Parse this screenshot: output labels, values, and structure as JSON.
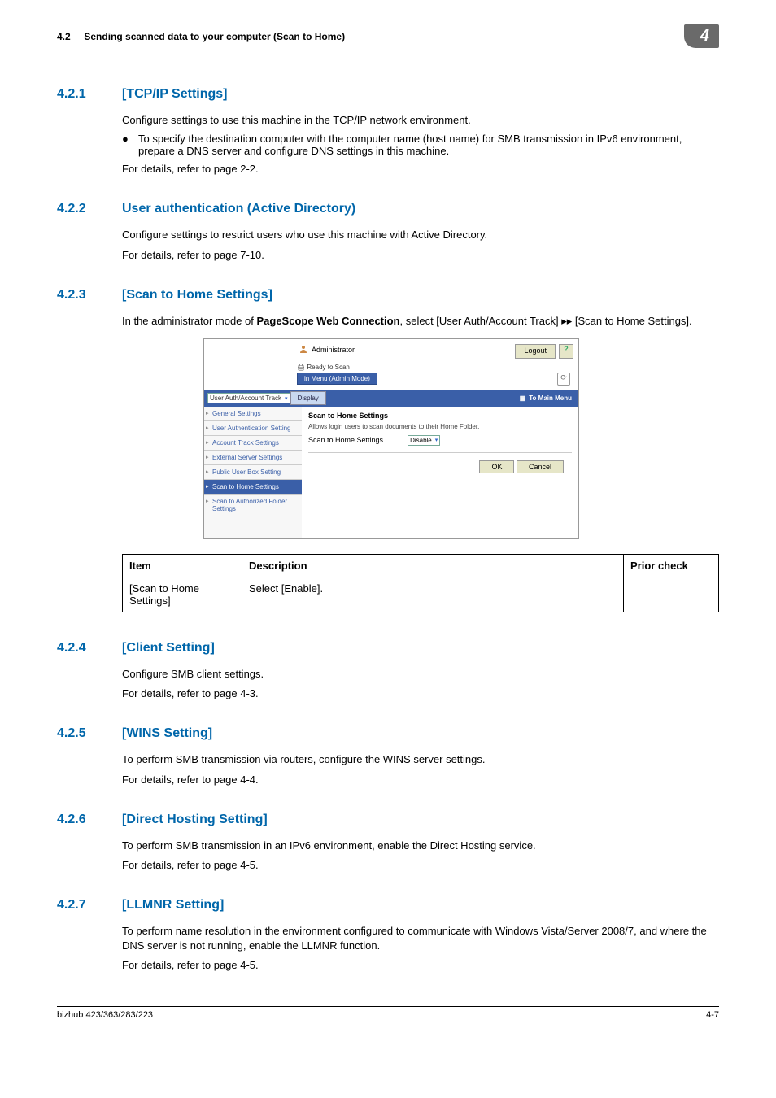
{
  "header": {
    "section_num": "4.2",
    "section_title": "Sending scanned data to your computer (Scan to Home)",
    "chapter_badge": "4"
  },
  "sections": {
    "s421": {
      "num": "4.2.1",
      "title": "[TCP/IP Settings]",
      "p1": "Configure settings to use this machine in the TCP/IP network environment.",
      "bullet1": "To specify the destination computer with the computer name (host name) for SMB transmission in IPv6 environment, prepare a DNS server and configure DNS settings in this machine.",
      "p2": "For details, refer to page 2-2."
    },
    "s422": {
      "num": "4.2.2",
      "title": "User authentication (Active Directory)",
      "p1": "Configure settings to restrict users who use this machine with Active Directory.",
      "p2": "For details, refer to page 7-10."
    },
    "s423": {
      "num": "4.2.3",
      "title": "[Scan to Home Settings]",
      "p1_pre": "In the administrator mode of ",
      "p1_bold": "PageScope Web Connection",
      "p1_post": ", select [User Auth/Account Track] ▸▸ [Scan to Home Settings]."
    },
    "s424": {
      "num": "4.2.4",
      "title": "[Client Setting]",
      "p1": "Configure SMB client settings.",
      "p2": "For details, refer to page 4-3."
    },
    "s425": {
      "num": "4.2.5",
      "title": "[WINS Setting]",
      "p1": "To perform SMB transmission via routers, configure the WINS server settings.",
      "p2": "For details, refer to page 4-4."
    },
    "s426": {
      "num": "4.2.6",
      "title": "[Direct Hosting Setting]",
      "p1": "To perform SMB transmission in an IPv6 environment, enable the Direct Hosting service.",
      "p2": "For details, refer to page 4-5."
    },
    "s427": {
      "num": "4.2.7",
      "title": "[LLMNR Setting]",
      "p1": "To perform name resolution in the environment configured to communicate with Windows Vista/Server 2008/7, and where the DNS server is not running, enable the LLMNR function.",
      "p2": "For details, refer to page 4-5."
    }
  },
  "screenshot": {
    "admin_label": "Administrator",
    "logout": "Logout",
    "help": "?",
    "ready": "Ready to Scan",
    "menu_mode": "in Menu (Admin Mode)",
    "dropdown": "User Auth/Account Track",
    "display": "Display",
    "to_main_menu": "To Main Menu",
    "sidebar": {
      "i0": "General Settings",
      "i1": "User Authentication Setting",
      "i2": "Account Track Settings",
      "i3": "External Server Settings",
      "i4": "Public User Box Setting",
      "i5": "Scan to Home Settings",
      "i6": "Scan to Authorized Folder Settings"
    },
    "content": {
      "title": "Scan to Home Settings",
      "subtitle": "Allows login users to scan documents to their Home Folder.",
      "row_label": "Scan to Home Settings",
      "row_value": "Disable",
      "ok": "OK",
      "cancel": "Cancel"
    }
  },
  "table": {
    "h_item": "Item",
    "h_desc": "Description",
    "h_prior": "Prior check",
    "r1_item": "[Scan to Home Settings]",
    "r1_desc": "Select [Enable].",
    "r1_prior": ""
  },
  "footer": {
    "left": "bizhub 423/363/283/223",
    "right": "4-7"
  }
}
